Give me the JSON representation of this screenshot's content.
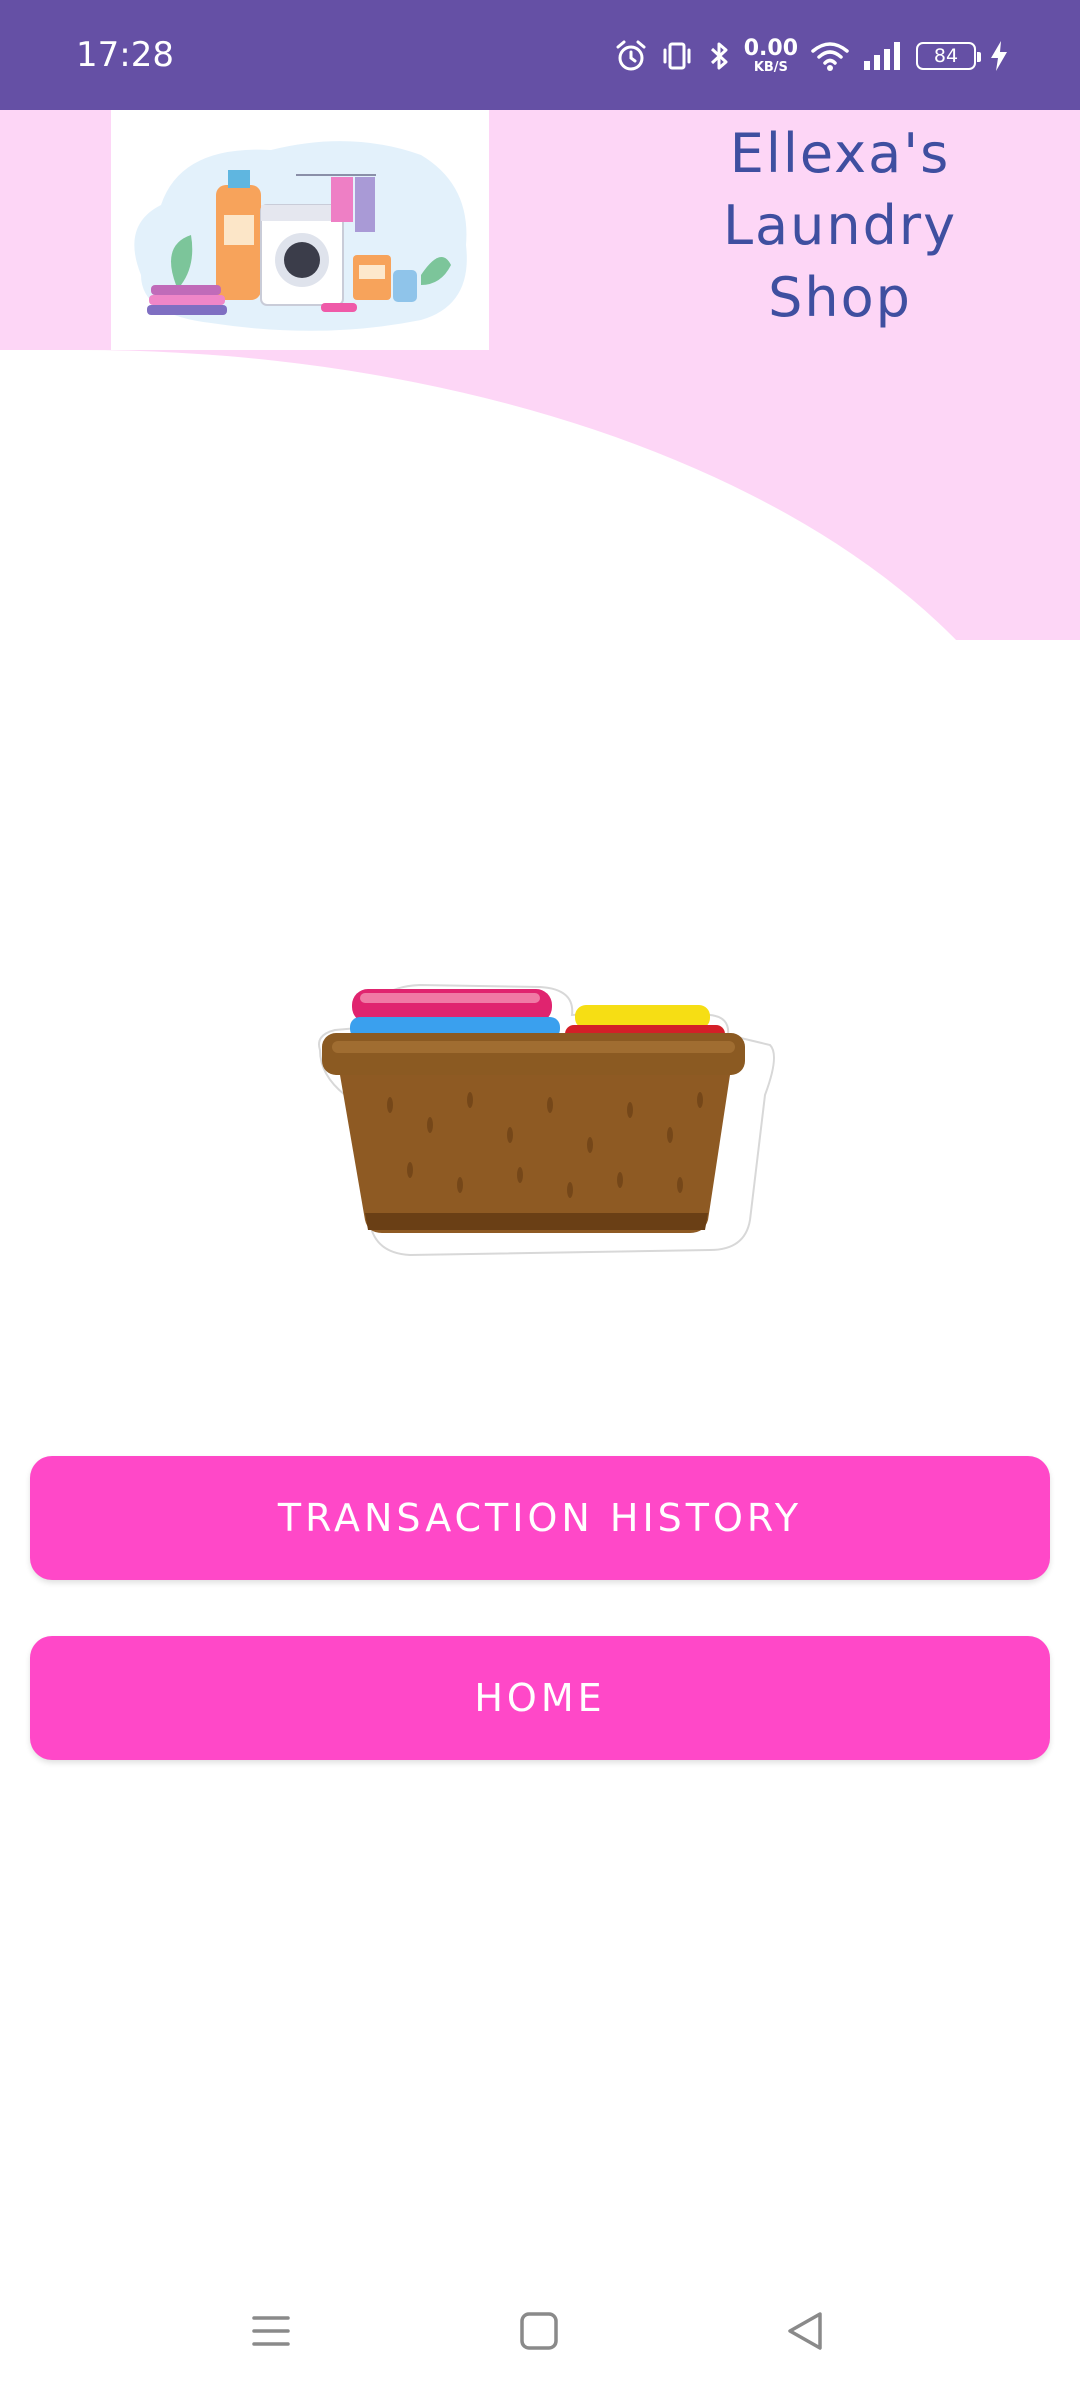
{
  "status_bar": {
    "time": "17:28",
    "net_speed_value": "0.00",
    "net_speed_unit": "KB/S",
    "battery_level": "84",
    "icons": [
      "alarm-icon",
      "vibrate-icon",
      "bluetooth-icon",
      "wifi-icon",
      "signal-icon",
      "battery-icon",
      "charging-icon"
    ]
  },
  "header": {
    "title_line_1": "Ellexa's",
    "title_line_2": "Laundry",
    "title_line_3": "Shop",
    "logo": "laundry-logo-illustration",
    "background_color": "#fdd6f6",
    "title_color": "#3f4fa0"
  },
  "main": {
    "illustration": "laundry-basket-illustration",
    "buttons": {
      "transaction_history": "TRANSACTION HISTORY",
      "home": "HOME"
    },
    "button_color": "#ff48c8"
  },
  "nav_bar": {
    "icons": [
      "menu-icon",
      "home-square-icon",
      "back-triangle-icon"
    ]
  },
  "colors": {
    "status_bar": "#6550a5"
  }
}
